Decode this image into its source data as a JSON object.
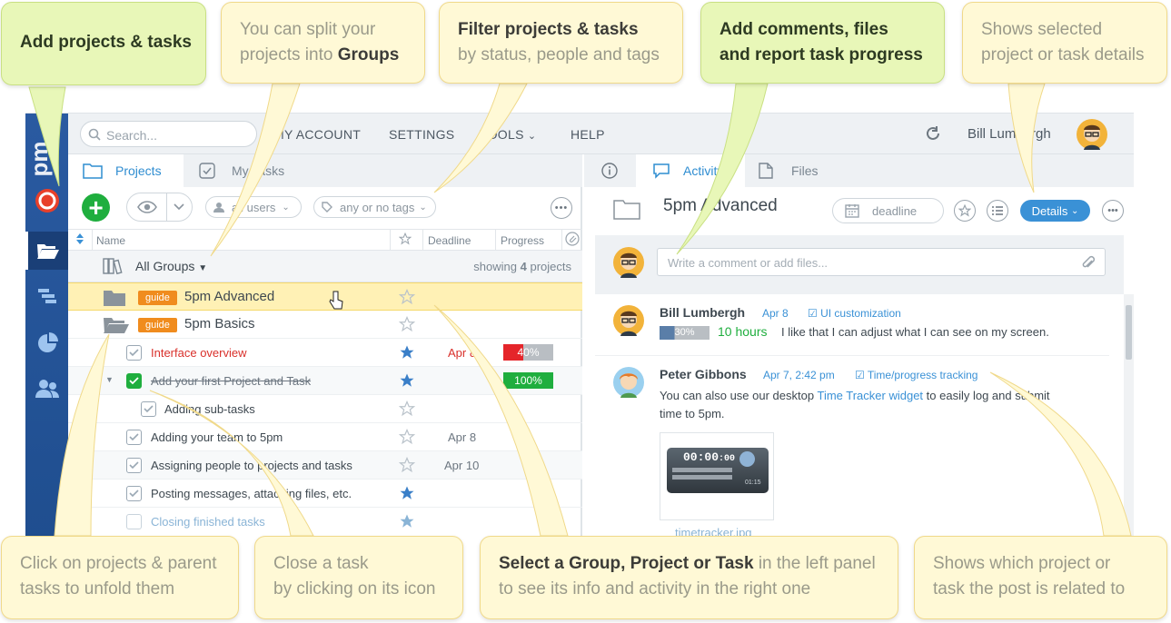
{
  "topbar": {
    "search_placeholder": "Search...",
    "menu": [
      "MY ACCOUNT",
      "SETTINGS",
      "TOOLS",
      "HELP"
    ],
    "user_name": "Bill Lumbergh"
  },
  "sidebar": {
    "logo_text": "5pm",
    "items": [
      "projects-folder",
      "gantt",
      "reports-pie",
      "people"
    ]
  },
  "left_panel": {
    "tabs": [
      "Projects",
      "My Tasks"
    ],
    "filters": {
      "users": "all users",
      "tags": "any or no tags"
    },
    "columns": [
      "Name",
      "Deadline",
      "Progress"
    ],
    "all_groups": {
      "label": "All Groups",
      "showing_prefix": "showing",
      "showing_count": "4",
      "showing_suffix": "projects"
    },
    "projects": [
      {
        "badge": "guide",
        "name": "5pm Advanced"
      },
      {
        "badge": "guide",
        "name": "5pm Basics"
      }
    ],
    "tasks": [
      {
        "name": "Interface overview",
        "deadline": "Apr 8",
        "progress": "40%"
      },
      {
        "name": "Add your first Project and Task",
        "deadline": "",
        "progress": "100%"
      },
      {
        "name": "Adding sub-tasks",
        "deadline": "",
        "progress": ""
      },
      {
        "name": "Adding your team to 5pm",
        "deadline": "Apr 8",
        "progress": ""
      },
      {
        "name": "Assigning people to projects and tasks",
        "deadline": "Apr 10",
        "progress": ""
      },
      {
        "name": "Posting messages, attaching files, etc.",
        "deadline": "",
        "progress": ""
      },
      {
        "name": "Closing finished tasks",
        "deadline": "",
        "progress": ""
      }
    ]
  },
  "right_panel": {
    "tabs": [
      "Activity",
      "Files"
    ],
    "title": "5pm Advanced",
    "deadline_label": "deadline",
    "details_label": "Details",
    "comment_placeholder": "Write a comment or add files...",
    "posts": [
      {
        "author": "Bill Lumbergh",
        "date": "Apr 8",
        "related": "UI customization",
        "progress": "30%",
        "hours": "10 hours",
        "text": "I like that I can adjust what I can see on my screen."
      },
      {
        "author": "Peter Gibbons",
        "date": "Apr 7, 2:42 pm",
        "related": "Time/progress tracking",
        "text_before": "You can also use our desktop",
        "link": "Time Tracker widget",
        "text_after": "to easily log and submit time to 5pm.",
        "widget_time": "00:00",
        "widget_secs": ":00",
        "widget_small": "01:15",
        "attachment": "timetracker.jpg"
      }
    ]
  },
  "callouts": {
    "add": "Add projects & tasks",
    "groups_pre": "You can split your",
    "groups_mid": "projects into",
    "groups_bold": "Groups",
    "filter_bold": "Filter projects & tasks",
    "filter_rest": "by status, people and tags",
    "comments_line1": "Add comments, files",
    "comments_line2": "and report task progress",
    "details_line1": "Shows selected",
    "details_line2": "project or task details",
    "unfold_line1": "Click on projects & parent",
    "unfold_line2": "tasks to unfold them",
    "close_line1": "Close a task",
    "close_line2": "by clicking on its icon",
    "select_bold": "Select a Group, Project or Task",
    "select_rest1": "in the left panel",
    "select_rest2": "to see its info and activity in the right one",
    "related_line1": "Shows which project or",
    "related_line2": "task the post is related to"
  },
  "colors": {
    "accent": "#3a91d6",
    "add_green": "#1fae3e",
    "guide_orange": "#f08c1e",
    "progress_red": "#e5252a",
    "sidebar_blue": "#2a5aa1",
    "callout_yellow": "#fff9d6",
    "callout_green": "#e8f7b8"
  }
}
